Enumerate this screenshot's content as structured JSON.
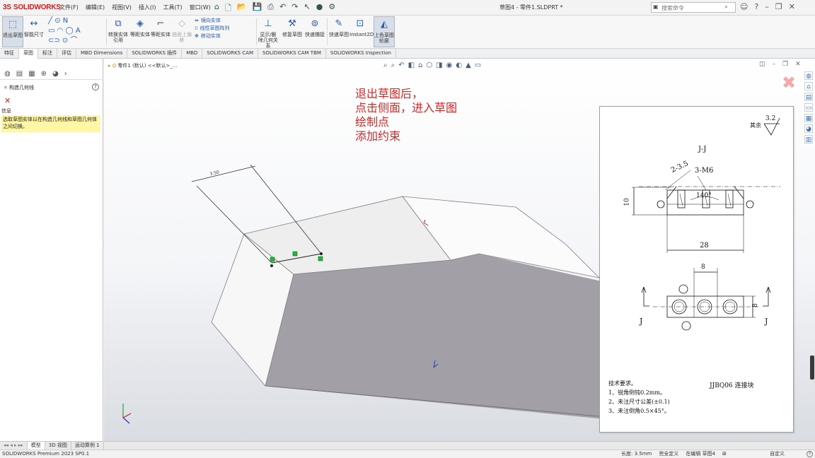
{
  "app": {
    "logo_mark": "3S",
    "logo_text": "SOLIDWORKS",
    "window_title": "草图4 - 零件1.SLDPRT *",
    "menus": [
      "文件(F)",
      "编辑(E)",
      "视图(V)",
      "插入(I)",
      "工具(T)",
      "窗口(W)"
    ],
    "search_placeholder": "搜索命令"
  },
  "ribbon": {
    "exit_sketch": "退出草图",
    "smart_dimension": "智能尺寸",
    "convert_entities": "转换实体引用",
    "offset_entities": "等距实体",
    "offset_surface": "等距实体",
    "on_surface": "曲面上偏移",
    "mirror": "镜向实体",
    "linear_pattern": "线性草图阵列",
    "move_entities": "移动实体",
    "relations": "显示/删除几何关系",
    "repair_sketch": "修复草图",
    "quick_snaps": "快速捕捉",
    "rapid_sketch": "快速草图",
    "instant2d": "Instant2D",
    "shaded_contours": "上色草图轮廓"
  },
  "tabs": [
    "特征",
    "草图",
    "标注",
    "评估",
    "MBD Dimensions",
    "SOLIDWORKS 插件",
    "MBD",
    "SOLIDWORKS CAM",
    "SOLIDWORKS CAM TBM",
    "SOLIDWORKS Inspection"
  ],
  "active_tab": "草图",
  "property_manager": {
    "title": "构造几何线",
    "info_header": "信息",
    "info_text": "选取草图实体以在构造几何线和草图几何体之间切换。"
  },
  "viewport": {
    "tree_item": "零件1 (默认) <<默认>_...",
    "annotation_lines": [
      "退出草图后，",
      "点击侧面，进入草图",
      "绘制点",
      "添加约束"
    ],
    "sketch_dim": "3.50"
  },
  "drawing": {
    "roughness_prefix": "其余",
    "roughness_value": "3.2",
    "section_title": "J-J",
    "dim_chamfer": "2-3.5",
    "dim_holes": "3-M6",
    "dim_angle": "140°",
    "dim_height": "10",
    "dim_width": "28",
    "dim_spacing": "8",
    "dim_thickness": "8",
    "section_mark": "J",
    "requirements_title": "技术要求。",
    "requirements": [
      "1、锐角倒钝0.2mm。",
      "2、未注尺寸公差(±0.1)",
      "3、未注倒角0.5×45°。"
    ],
    "part_name": "JJBQ06 连接块"
  },
  "bottom_tabs": [
    "模型",
    "3D 视图",
    "运动算例 1"
  ],
  "status": {
    "version": "SOLIDWORKS Premium 2023 SP0.1",
    "length": "长度: 3.5mm",
    "defined": "完全定义",
    "editing": "在编辑 草图4",
    "units": "自定义"
  }
}
